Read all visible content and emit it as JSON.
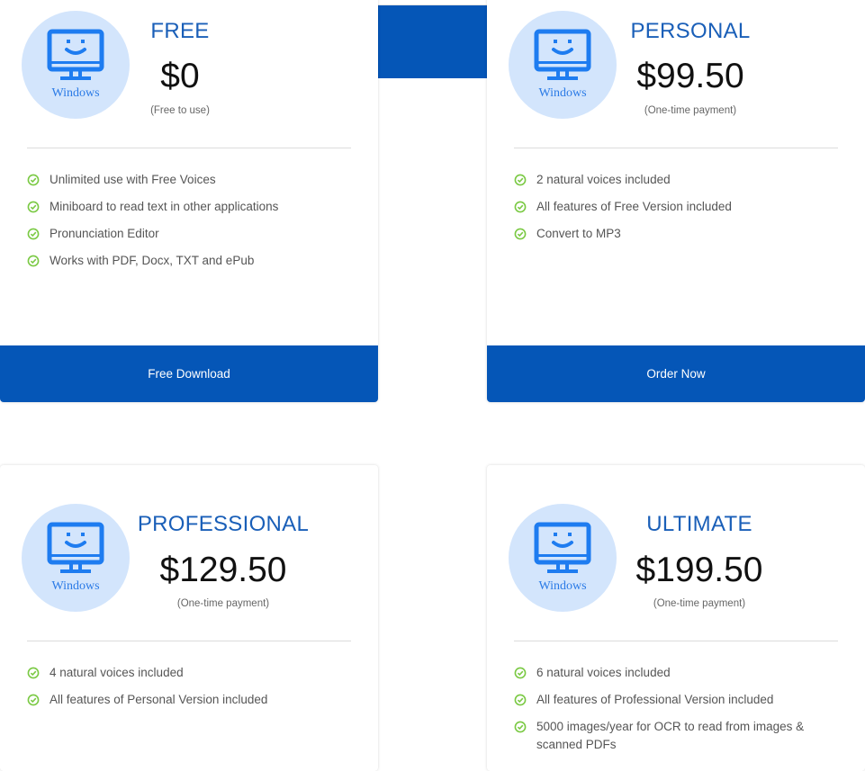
{
  "colors": {
    "accent_blue": "#0556b7",
    "title_blue": "#1a5fb8",
    "icon_blue": "#2a7ae6",
    "icon_circle_bg": "#d3e5fc",
    "check_green": "#7ac943"
  },
  "plans": [
    {
      "title": "FREE",
      "price": "$0",
      "price_note": "(Free to use)",
      "os_icon": "monitor-smile-icon",
      "os_label": "Windows",
      "features": [
        "Unlimited use with Free Voices",
        "Miniboard to read text in other applications",
        "Pronunciation Editor",
        "Works with PDF, Docx, TXT and ePub"
      ],
      "button_label": "Free Download"
    },
    {
      "title": "PERSONAL",
      "price": "$99.50",
      "price_note": "(One-time payment)",
      "os_icon": "monitor-smile-icon",
      "os_label": "Windows",
      "features": [
        "2 natural voices included",
        "All features of Free Version included",
        "Convert to MP3"
      ],
      "button_label": "Order Now"
    },
    {
      "title": "PROFESSIONAL",
      "price": "$129.50",
      "price_note": "(One-time payment)",
      "os_icon": "monitor-smile-icon",
      "os_label": "Windows",
      "features": [
        "4 natural voices included",
        "All features of Personal Version included"
      ]
    },
    {
      "title": "ULTIMATE",
      "price": "$199.50",
      "price_note": "(One-time payment)",
      "os_icon": "monitor-smile-icon",
      "os_label": "Windows",
      "features": [
        "6 natural voices included",
        "All features of Professional Version included",
        "5000 images/year for OCR to read from images & scanned PDFs"
      ]
    }
  ]
}
